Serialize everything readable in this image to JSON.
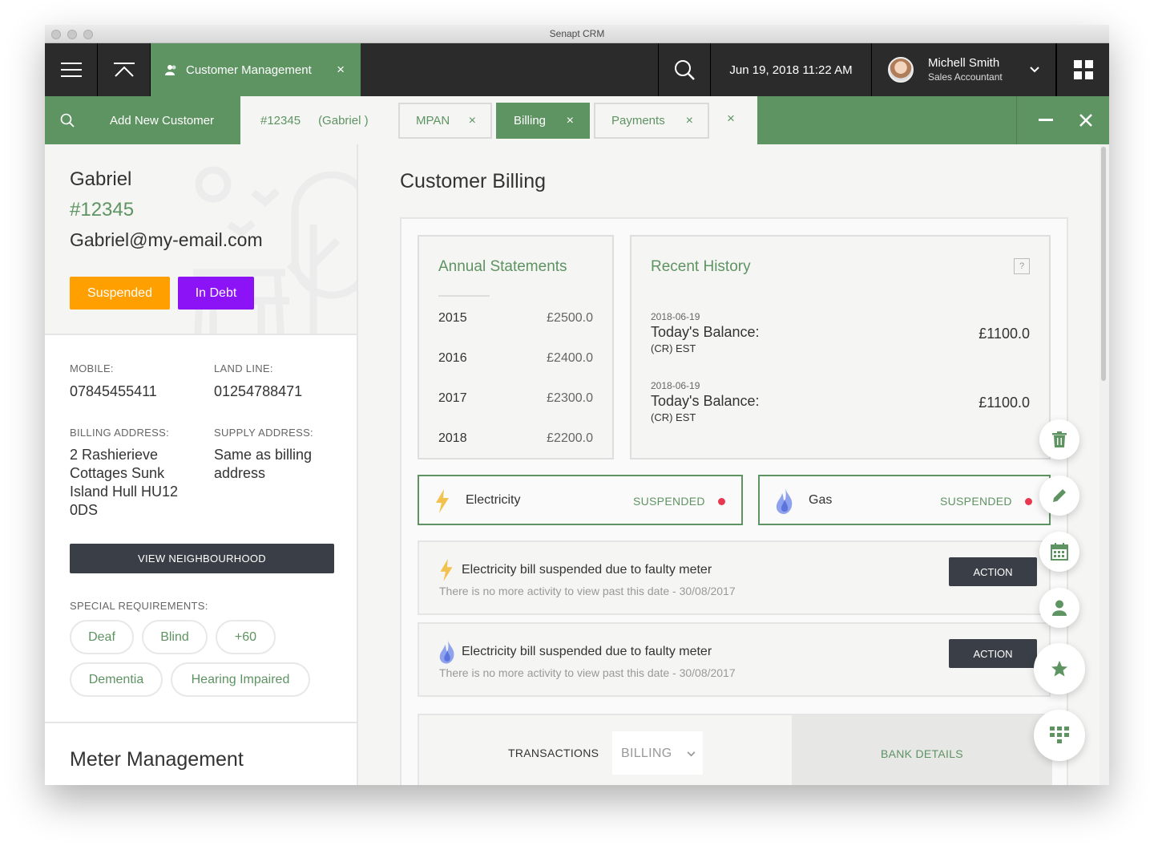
{
  "window": {
    "title": "Senapt CRM"
  },
  "topbar": {
    "active_module": "Customer Management",
    "close_symbol": "×",
    "datetime": "Jun 19, 2018 11:22 AM",
    "user": {
      "name": "Michell Smith",
      "role": "Sales Accountant"
    }
  },
  "tabs": {
    "add_new": "Add New Customer",
    "first": {
      "id": "#12345",
      "name": "(Gabriel )"
    },
    "items": [
      {
        "label": "MPAN",
        "active": false
      },
      {
        "label": "Billing",
        "active": true
      },
      {
        "label": "Payments",
        "active": false
      }
    ],
    "close_symbol": "×"
  },
  "customer": {
    "name": "Gabriel",
    "id": "#12345",
    "email": "Gabriel@my-email.com",
    "badges": [
      {
        "label": "Suspended",
        "color": "#ffa000"
      },
      {
        "label": "In Debt",
        "color": "#8b13f6"
      }
    ],
    "mobile_label": "MOBILE:",
    "mobile": "07845455411",
    "landline_label": "LAND LINE:",
    "landline": "01254788471",
    "billing_label": "BILLING ADDRESS:",
    "billing_lines": [
      "2 Rashierieve",
      "Cottages Sunk",
      "Island Hull HU12",
      "0DS"
    ],
    "supply_label": "SUPPLY ADDRESS:",
    "supply_lines": [
      "Same as billing",
      "address"
    ],
    "neighbourhood_button": "VIEW NEIGHBOURHOOD",
    "special_label": "SPECIAL REQUIREMENTS:",
    "requirements": [
      "Deaf",
      "Blind",
      "+60",
      "Dementia",
      "Hearing Impaired"
    ],
    "meter_title": "Meter Management"
  },
  "billing": {
    "title": "Customer Billing",
    "annual": {
      "title": "Annual Statements",
      "rows": [
        {
          "year": "2015",
          "amount": "£2500.0"
        },
        {
          "year": "2016",
          "amount": "£2400.0"
        },
        {
          "year": "2017",
          "amount": "£2300.0"
        },
        {
          "year": "2018",
          "amount": "£2200.0"
        }
      ]
    },
    "history": {
      "title": "Recent History",
      "help": "?",
      "entries": [
        {
          "date": "2018-06-19",
          "label": "Today's Balance:",
          "sub": "(CR) EST",
          "amount": "£1100.0"
        },
        {
          "date": "2018-06-19",
          "label": "Today's Balance:",
          "sub": "(CR) EST",
          "amount": "£1100.0"
        }
      ]
    },
    "utilities": [
      {
        "name": "Electricity",
        "status": "SUSPENDED",
        "icon": "lightning-icon"
      },
      {
        "name": "Gas",
        "status": "SUSPENDED",
        "icon": "flame-icon"
      }
    ],
    "alerts": [
      {
        "title": "Electricity bill suspended due to faulty meter",
        "sub": "There is no more activity to view past this date - 30/08/2017",
        "action": "ACTION",
        "icon": "lightning-icon"
      },
      {
        "title": "Electricity bill suspended due to faulty meter",
        "sub": "There is no more activity to view past this date - 30/08/2017",
        "action": "ACTION",
        "icon": "flame-icon"
      }
    ],
    "bottom": {
      "transactions": "TRANSACTIONS",
      "select_value": "BILLING",
      "bank": "BANK DETAILS"
    }
  },
  "colors": {
    "brand_green": "#5e9362",
    "dark": "#2b2b2b",
    "alert_red": "#e8384f",
    "orange": "#ffa000",
    "purple": "#8b13f6"
  },
  "fabs": [
    "trash-icon",
    "pencil-icon",
    "calendar-icon",
    "person-icon",
    "star-icon",
    "grid-icon"
  ]
}
